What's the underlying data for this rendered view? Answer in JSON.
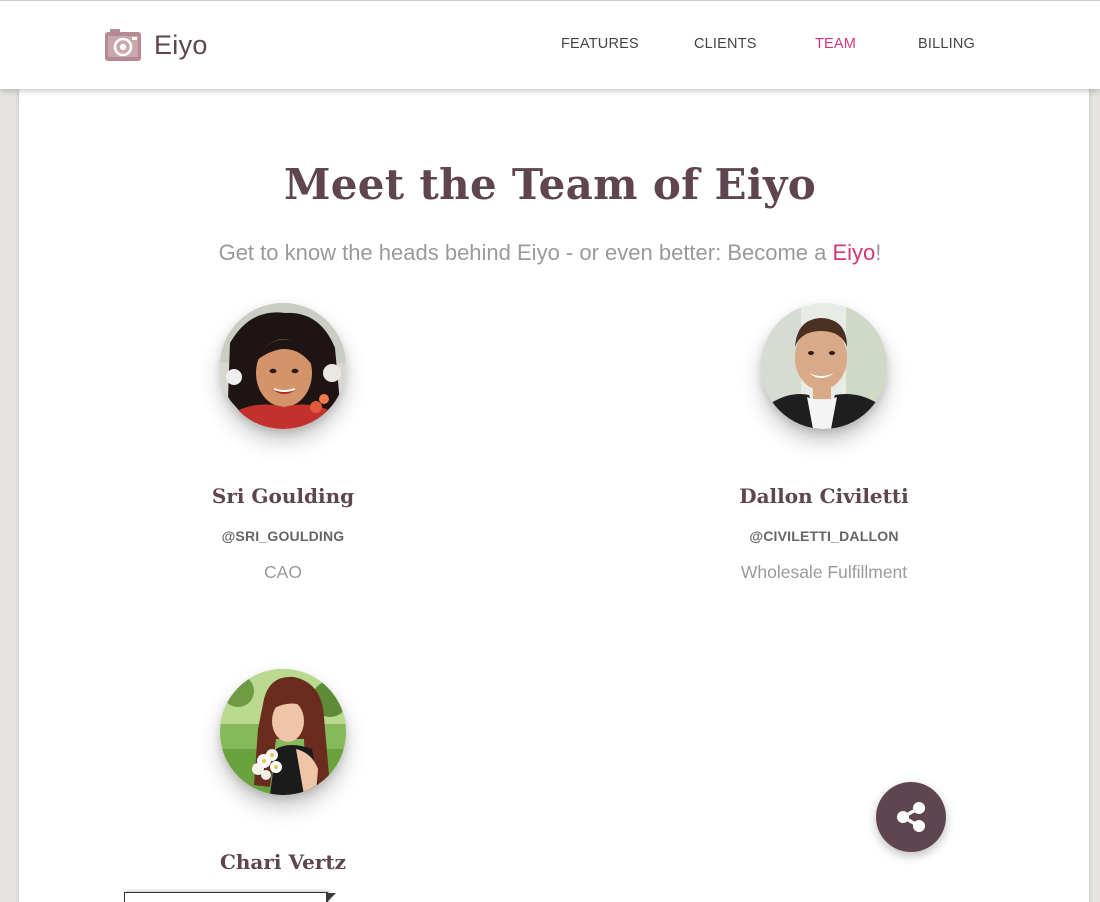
{
  "brand": {
    "name": "Eiyo",
    "logo_icon": "camera-icon"
  },
  "nav": {
    "items": [
      {
        "label": "FEATURES",
        "active": false
      },
      {
        "label": "CLIENTS",
        "active": false
      },
      {
        "label": "TEAM",
        "active": true
      },
      {
        "label": "BILLING",
        "active": false
      }
    ]
  },
  "team": {
    "title": "Meet the Team of Eiyo",
    "subtitle_prefix": "Get to know the heads behind Eiyo - or even better: Become a ",
    "subtitle_link": "Eiyo",
    "subtitle_suffix": "!",
    "members": [
      {
        "name": "Sri Goulding",
        "handle": "@SRI_GOULDING",
        "role": "CAO"
      },
      {
        "name": "Dallon Civiletti",
        "handle": "@CIVILETTI_DALLON",
        "role": "Wholesale Fulfillment"
      },
      {
        "name": "Chari Vertz"
      }
    ]
  },
  "fab": {
    "icon": "share-icon"
  },
  "colors": {
    "brand": "#5e4550",
    "accent": "#d6357a",
    "muted_text": "#9a9a9a",
    "page_bg": "#e6e4e0"
  }
}
